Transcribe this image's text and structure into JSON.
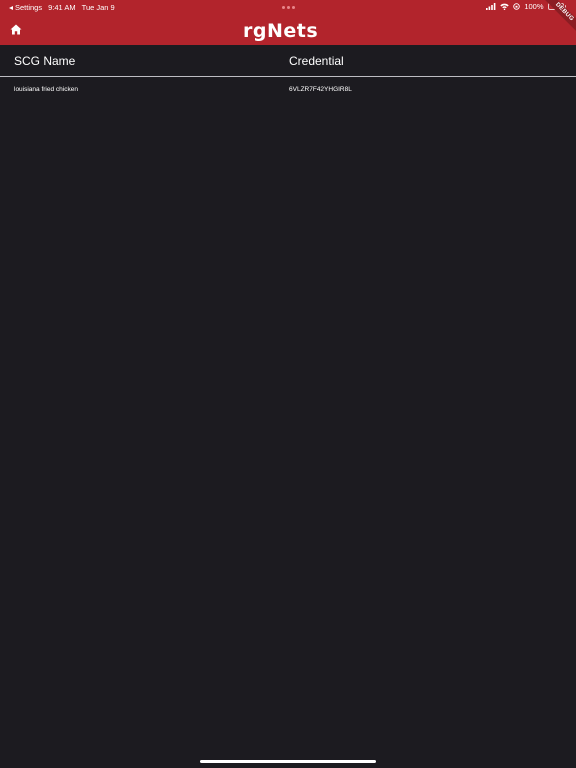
{
  "status_bar": {
    "back_app": "Settings",
    "time": "9:41 AM",
    "date": "Tue Jan 9",
    "battery": "100%",
    "battery_level": 1.0
  },
  "nav_bar": {
    "home_icon": "home-icon",
    "logo_part1": "rg",
    "logo_part2": "Nets",
    "debug_banner": "DEBUG"
  },
  "table": {
    "headers": [
      "SCG Name",
      "Credential"
    ],
    "rows": [
      [
        "louisiana fried chicken",
        "6VLZR7F42YHGIR8L"
      ]
    ]
  },
  "colors": {
    "brand": "#b2242c",
    "background": "#1c1b20",
    "divider": "#bdbdc2"
  }
}
